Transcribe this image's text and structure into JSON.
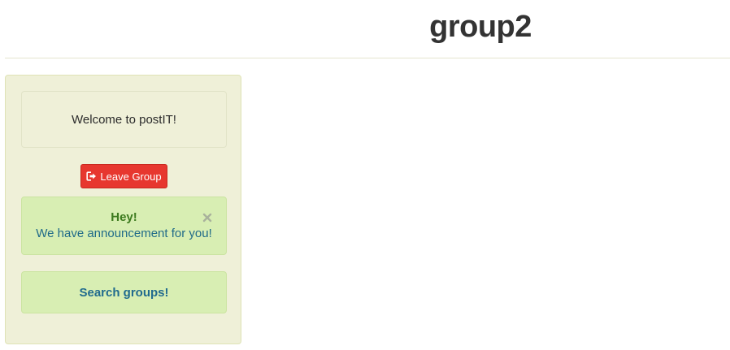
{
  "header": {
    "title": "group2"
  },
  "sidebar": {
    "welcome_text": "Welcome to postIT!",
    "leave_button": {
      "label": "Leave Group",
      "icon": "sign-out-icon"
    },
    "alert": {
      "heading": "Hey!",
      "message": "We have announcement for you!",
      "close_icon": "close-icon"
    },
    "search_link": "Search groups!"
  },
  "colors": {
    "sidebar_bg": "#eff0d8",
    "alert_bg": "#d8eeb3",
    "danger": "#e7372f",
    "alert_heading": "#3c7a1e",
    "alert_text": "#1f6a88"
  }
}
